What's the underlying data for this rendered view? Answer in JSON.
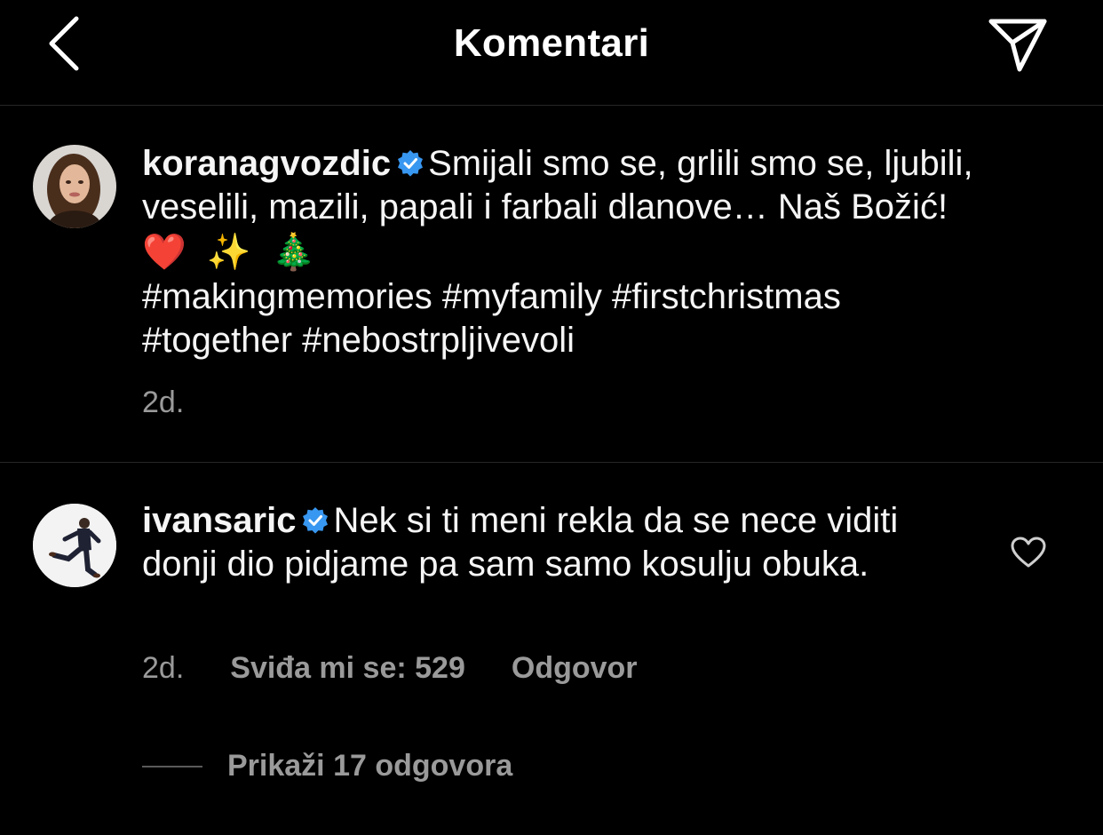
{
  "header": {
    "title": "Komentari",
    "back_icon": "chevron-left-icon",
    "share_icon": "paper-plane-icon"
  },
  "caption": {
    "username": "koranagvozdic",
    "verified": true,
    "text": "Smijali smo se, grlili smo se, ljubili, veselili, mazili, papali i farbali dlanove… Naš Božić!",
    "emojis": "❤️ ✨ 🎄",
    "hashtags_line1": "#makingmemories #myfamily #firstchristmas",
    "hashtags_line2": "#together #nebostrpljivevoli",
    "time": "2d."
  },
  "comment": {
    "username": "ivansaric",
    "verified": true,
    "text": "Nek si ti meni rekla da se nece viditi donji dio pidjame pa sam samo kosulju obuka.",
    "time": "2d.",
    "likes": "Sviđa mi se: 529",
    "reply": "Odgovor",
    "view_replies": "Prikaži 17 odgovora"
  },
  "colors": {
    "background": "#000000",
    "text": "#f5f5f5",
    "secondary": "#9a9a9a",
    "verified": "#3897f0",
    "divider": "#262626"
  }
}
